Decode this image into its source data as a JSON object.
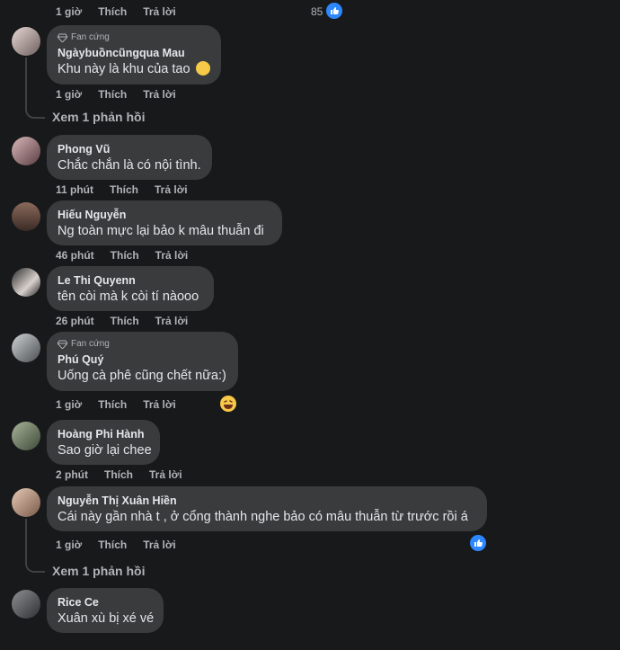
{
  "actions": {
    "like": "Thích",
    "reply": "Trả lời"
  },
  "top_row": {
    "time": "1 giờ",
    "reaction_count": "85"
  },
  "comments": [
    {
      "author": "Ngàybuồncũngqua Mau",
      "badge": "Fan cứng",
      "text": "Khu này là khu của tao",
      "time": "1 giờ",
      "view_replies": "Xem 1 phản hồi"
    },
    {
      "author": "Phong Vũ",
      "text": "Chắc chắn là có nội tình.",
      "time": "11 phút"
    },
    {
      "author": "Hiếu Nguyễn",
      "text": "Ng toàn mực lại bảo k mâu thuẫn đi",
      "time": "46 phút"
    },
    {
      "author": "Le Thi Quyenn",
      "text": "tên còi mà k còi tí nàooo",
      "time": "26 phút"
    },
    {
      "author": "Phú Quý",
      "badge": "Fan cứng",
      "text": "Uống cà phê cũng chết nữa:)",
      "time": "1 giờ"
    },
    {
      "author": "Hoàng Phi Hành",
      "text": "Sao giờ lại chee",
      "time": "2 phút"
    },
    {
      "author": "Nguyễn Thị Xuân Hiền",
      "text": "Cái này gần nhà t , ở cổng thành nghe bảo có mâu thuẫn từ trước rồi á",
      "time": "1 giờ",
      "view_replies": "Xem 1 phản hồi"
    },
    {
      "author": "Rice Ce",
      "text": "Xuân xù bị xé vé"
    }
  ]
}
